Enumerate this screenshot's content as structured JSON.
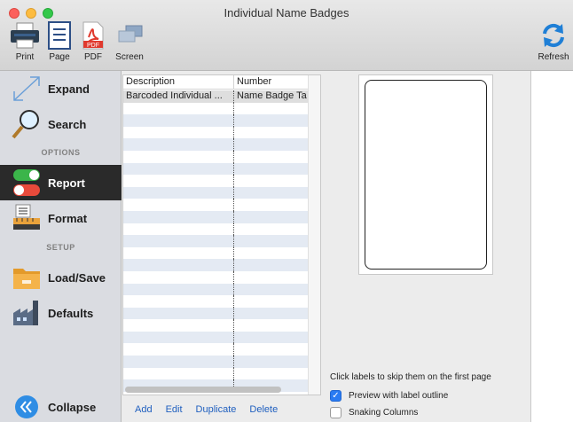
{
  "window": {
    "title": "Individual Name Badges"
  },
  "toolbar": {
    "print_label": "Print",
    "page_label": "Page",
    "pdf_label": "PDF",
    "pdf_badge": "PDF",
    "screen_label": "Screen",
    "refresh_label": "Refresh"
  },
  "sidebar": {
    "expand": "Expand",
    "search": "Search",
    "options_header": "OPTIONS",
    "report": "Report",
    "format": "Format",
    "setup_header": "SETUP",
    "load_save": "Load/Save",
    "defaults": "Defaults",
    "collapse": "Collapse"
  },
  "table": {
    "columns": [
      "Description",
      "Number"
    ],
    "rows": [
      {
        "description": "Barcoded Individual ...",
        "number": "Name Badge Ta"
      }
    ]
  },
  "actions": {
    "add": "Add",
    "edit": "Edit",
    "duplicate": "Duplicate",
    "delete": "Delete"
  },
  "preview": {
    "hint": "Click labels to skip them on the first page",
    "preview_outline_label": "Preview with label outline",
    "preview_outline_checked": true,
    "snaking_label": "Snaking Columns",
    "snaking_checked": false
  },
  "colors": {
    "accent": "#2a7bf2",
    "link": "#1f5fbf",
    "active_sidebar": "#2a2a2a"
  }
}
